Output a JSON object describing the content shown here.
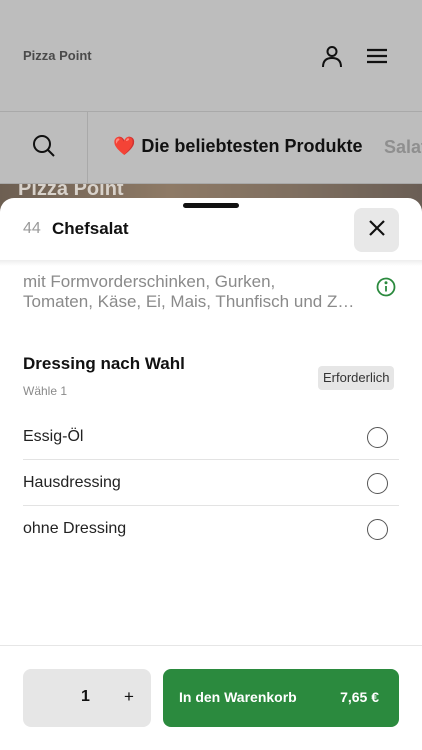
{
  "header": {
    "brand": "Pizza Point",
    "user_icon": "user-icon",
    "menu_icon": "menu-icon"
  },
  "category_bar": {
    "search_icon": "search-icon",
    "active_emoji": "❤️",
    "active_label": "Die beliebtesten Produkte",
    "next_label": "Salat"
  },
  "hero": {
    "text": "Pizza Point"
  },
  "product": {
    "number": "44",
    "name": "Chefsalat",
    "description_line1": "mit Formvorderschinken, Gurken,",
    "description_line2": "Tomaten, Käse, Ei, Mais, Thunfisch und Z…",
    "info_icon": "info-icon",
    "close_icon": "close-icon"
  },
  "option_group": {
    "title": "Dressing nach Wahl",
    "subtitle": "Wähle 1",
    "badge": "Erforderlich",
    "options": [
      {
        "label": "Essig-Öl",
        "selected": false
      },
      {
        "label": "Hausdressing",
        "selected": false
      },
      {
        "label": "ohne Dressing",
        "selected": false
      }
    ]
  },
  "footer": {
    "quantity": "1",
    "plus": "+",
    "cart_label": "In den Warenkorb",
    "price": "7,65 €"
  },
  "colors": {
    "accent": "#2b8a3e",
    "info": "#2b8a3e",
    "heart": "#e53935"
  }
}
